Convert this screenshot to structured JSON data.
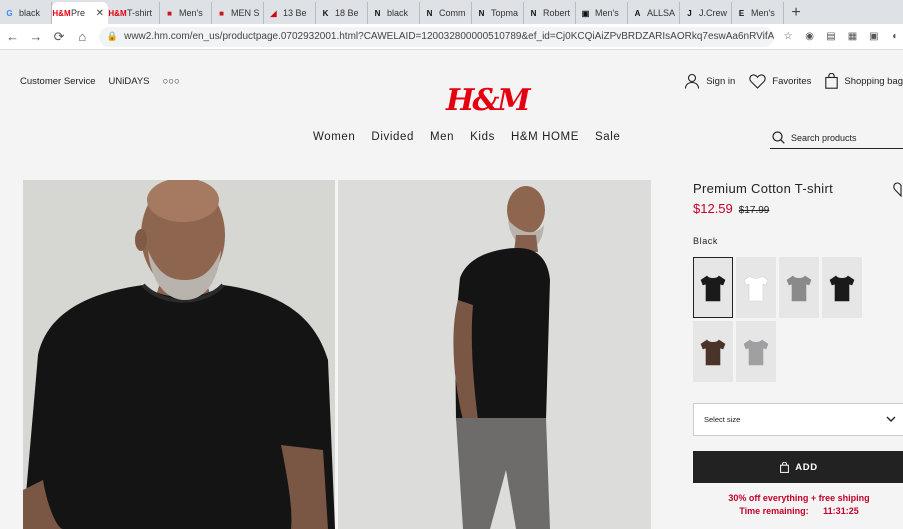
{
  "browser": {
    "tabs": [
      {
        "label": "black",
        "fav": "G",
        "favcolor": "#4285f4",
        "active": false
      },
      {
        "label": "Pre",
        "fav": "H&M",
        "favcolor": "#e50010",
        "active": true
      },
      {
        "label": "T-shirt",
        "fav": "H&M",
        "favcolor": "#e50010",
        "active": false
      },
      {
        "label": "Men's",
        "fav": "■",
        "favcolor": "#c4161c",
        "active": false
      },
      {
        "label": "MEN S",
        "fav": "■",
        "favcolor": "#c4161c",
        "active": false
      },
      {
        "label": "13 Be",
        "fav": "◢",
        "favcolor": "#d0021b",
        "active": false
      },
      {
        "label": "18 Be",
        "fav": "K",
        "favcolor": "#111111",
        "active": false
      },
      {
        "label": "black",
        "fav": "N",
        "favcolor": "#111111",
        "active": false
      },
      {
        "label": "Comm",
        "fav": "N",
        "favcolor": "#111111",
        "active": false
      },
      {
        "label": "Topma",
        "fav": "N",
        "favcolor": "#111111",
        "active": false
      },
      {
        "label": "Robert",
        "fav": "N",
        "favcolor": "#111111",
        "active": false
      },
      {
        "label": "Men's",
        "fav": "▣",
        "favcolor": "#111111",
        "active": false
      },
      {
        "label": "ALLSA",
        "fav": "A",
        "favcolor": "#111111",
        "active": false
      },
      {
        "label": "J.Crew",
        "fav": "J",
        "favcolor": "#111111",
        "active": false
      },
      {
        "label": "Men's",
        "fav": "E",
        "favcolor": "#111111",
        "active": false
      }
    ],
    "new_tab": "+",
    "url": "www2.hm.com/en_us/productpage.0702932001.html?CAWELAID=120032800000510789&ef_id=Cj0KCQiAiZPvBRDZARIsAORkq7eswAa6nRVifAjdyQvD..."
  },
  "header": {
    "util_links": [
      "Customer Service",
      "UNiDAYS",
      "○○○"
    ],
    "sign_in": "Sign in",
    "favorites": "Favorites",
    "bag": "Shopping bag",
    "logo": "H&M",
    "nav": [
      "Women",
      "Divided",
      "Men",
      "Kids",
      "H&M HOME",
      "Sale"
    ],
    "search_placeholder": "Search products"
  },
  "product": {
    "title": "Premium Cotton T-shirt",
    "price_sale": "$12.59",
    "price_original": "$17.99",
    "color_label": "Black",
    "swatches": [
      {
        "name": "black",
        "color": "#1a1a1a",
        "selected": true
      },
      {
        "name": "white",
        "color": "#ffffff",
        "selected": false
      },
      {
        "name": "gray-pattern",
        "color": "#8a8a8a",
        "selected": false
      },
      {
        "name": "black-2",
        "color": "#1a1a1a",
        "selected": false
      },
      {
        "name": "brown-pattern",
        "color": "#4a3329",
        "selected": false
      },
      {
        "name": "gray-2",
        "color": "#a0a0a2",
        "selected": false
      }
    ],
    "size_select": "Select size",
    "add_button": "ADD",
    "promo_line1": "30% off everything + free shiping",
    "promo_line2_label": "Time remaining:",
    "promo_line2_time": "11:31:25"
  },
  "colors": {
    "accent_red": "#e50010",
    "sale_red": "#c4002b",
    "button_dark": "#222222"
  }
}
